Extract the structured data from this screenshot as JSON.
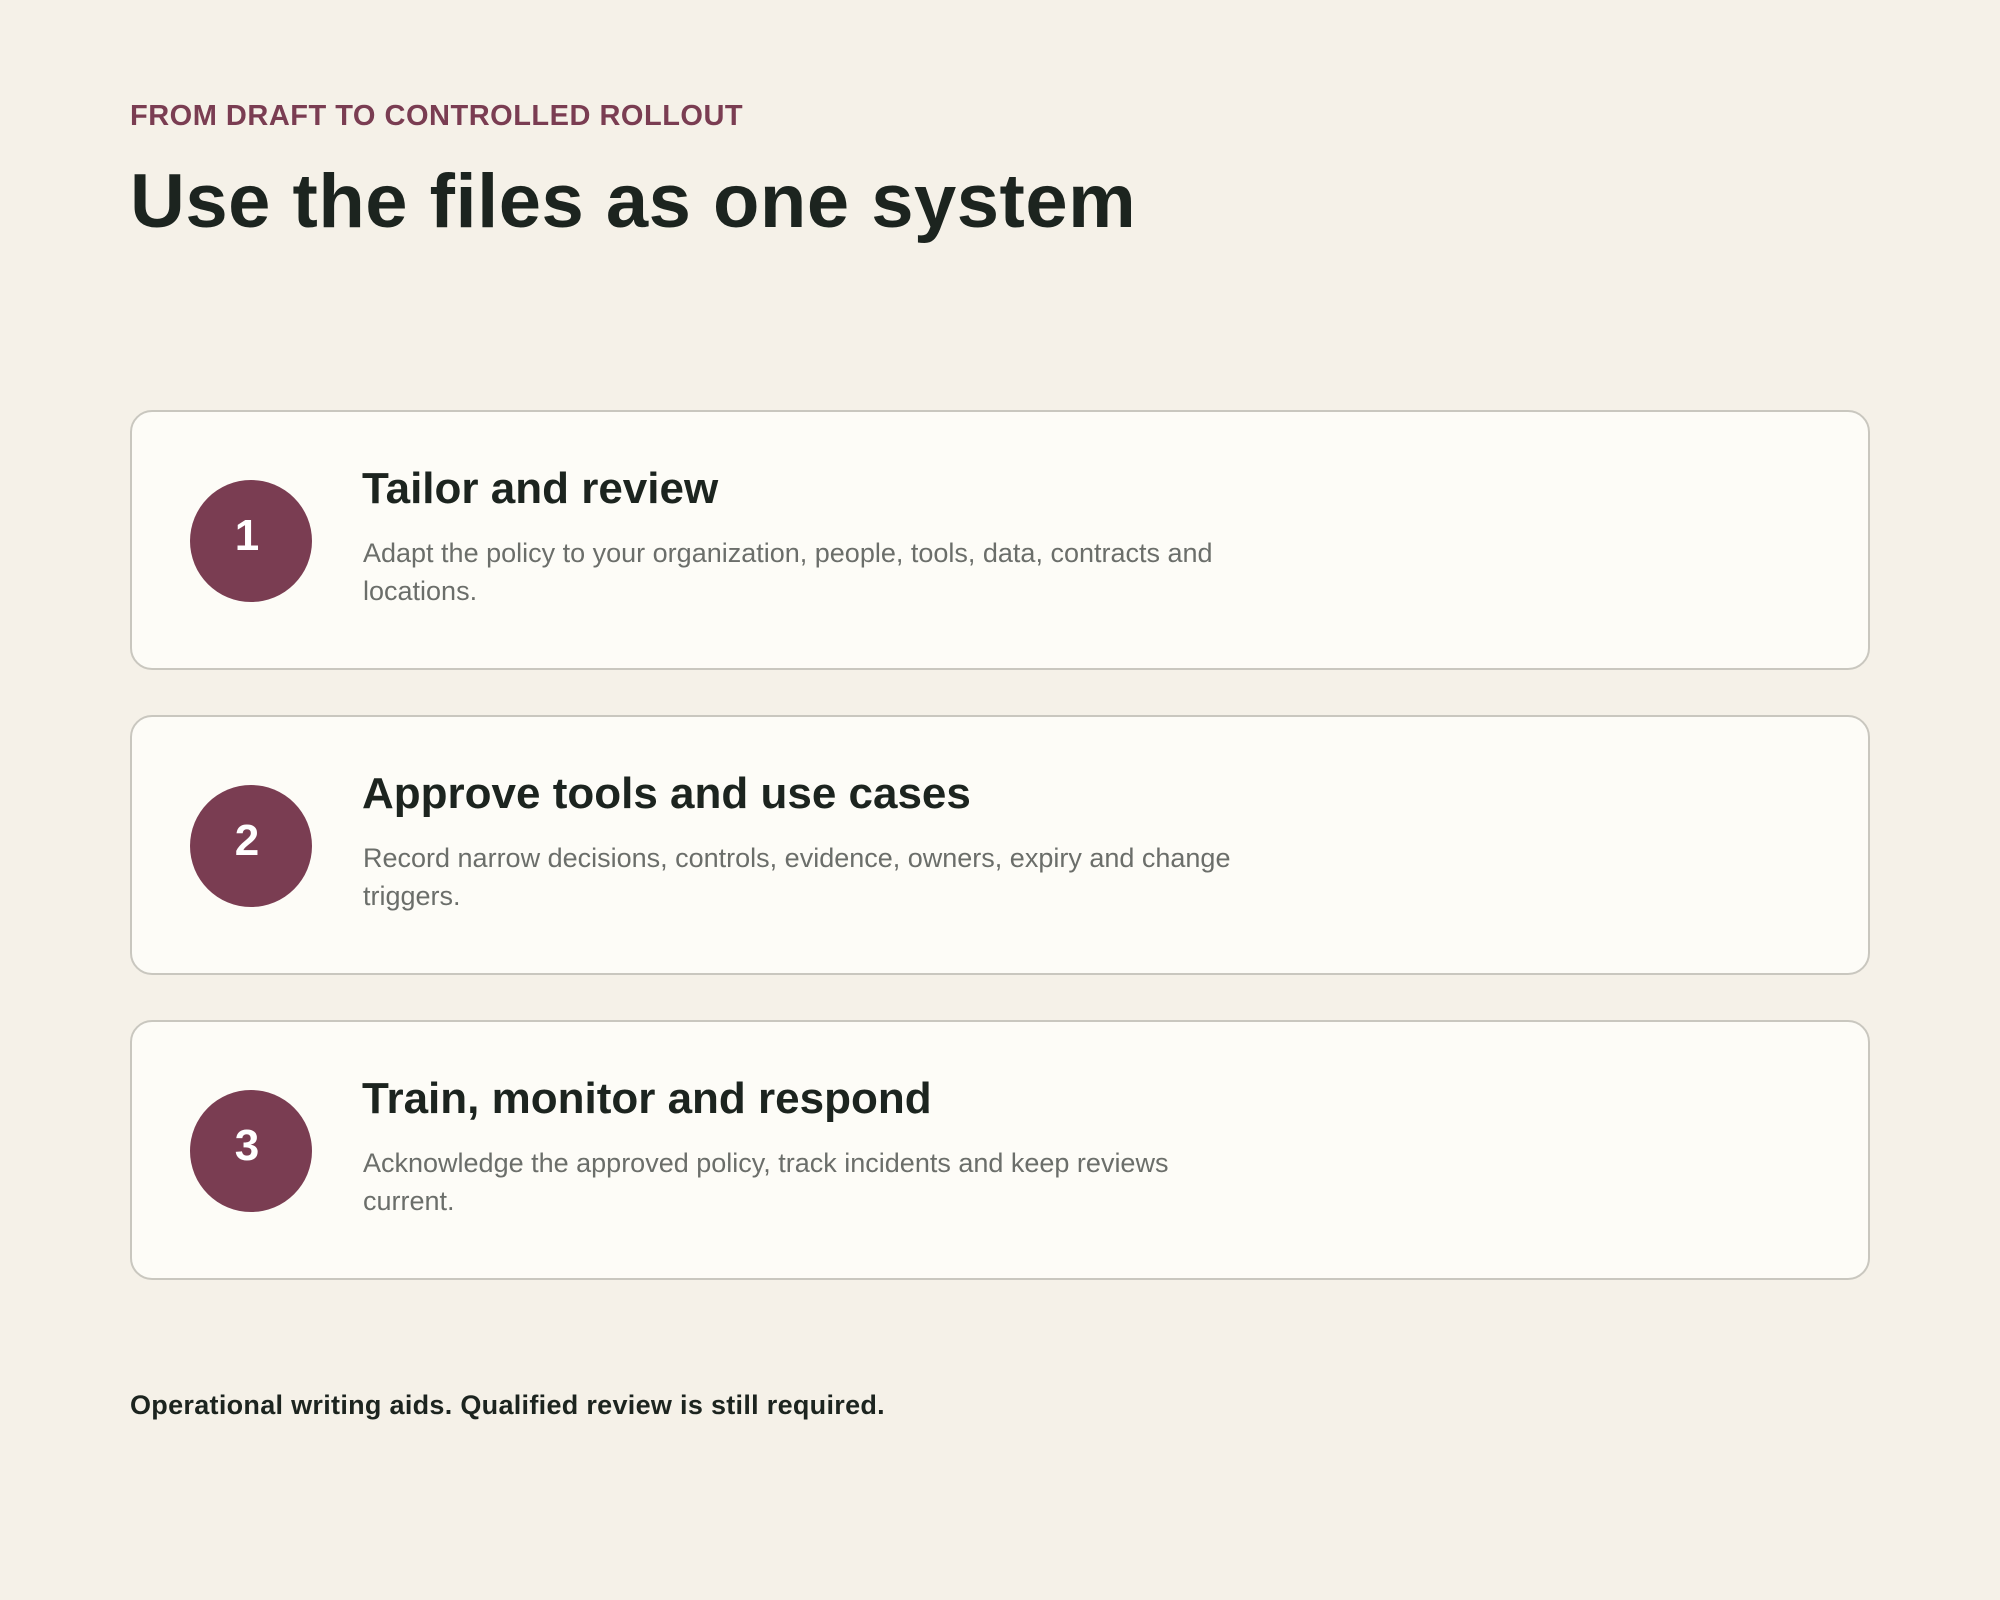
{
  "header": {
    "eyebrow": "FROM DRAFT TO CONTROLLED ROLLOUT",
    "title": "Use the files as one system"
  },
  "steps": [
    {
      "number": "1",
      "title": "Tailor and review",
      "description": "Adapt the policy to your organization, people, tools, data, contracts and locations."
    },
    {
      "number": "2",
      "title": "Approve tools and use cases",
      "description": "Record narrow decisions, controls, evidence, owners, expiry and change triggers."
    },
    {
      "number": "3",
      "title": "Train, monitor and respond",
      "description": "Acknowledge the approved policy, track incidents and keep reviews current."
    }
  ],
  "footer": {
    "note": "Operational writing aids. Qualified review is still required."
  },
  "colors": {
    "background": "#f5f1e8",
    "accent": "#7a3d52",
    "card": "#fdfcf7",
    "text": "#1c241f",
    "muted": "#6b6e6a"
  }
}
